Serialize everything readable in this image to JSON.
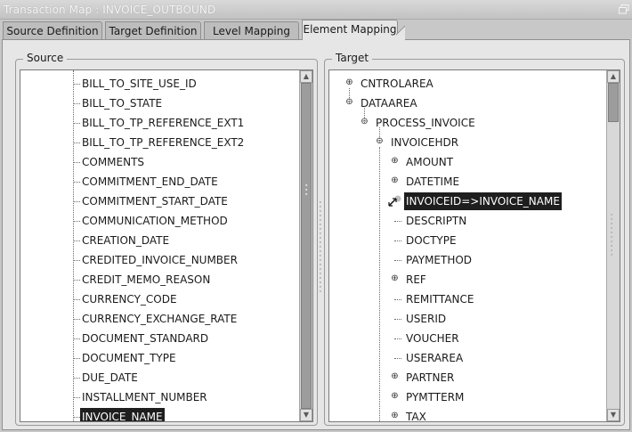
{
  "window": {
    "title": "Transaction Map : INVOICE_OUTBOUND",
    "restore_icon": "window-restore-icon"
  },
  "tabs": [
    {
      "label": "Source Definition",
      "active": false
    },
    {
      "label": "Target Definition",
      "active": false
    },
    {
      "label": "Level Mapping",
      "active": false
    },
    {
      "label": "Element Mapping",
      "active": true
    }
  ],
  "source": {
    "label": "Source",
    "items": [
      {
        "label": "BILL_TO_SITE_USE_ID",
        "selected": false
      },
      {
        "label": "BILL_TO_STATE",
        "selected": false
      },
      {
        "label": "BILL_TO_TP_REFERENCE_EXT1",
        "selected": false
      },
      {
        "label": "BILL_TO_TP_REFERENCE_EXT2",
        "selected": false
      },
      {
        "label": "COMMENTS",
        "selected": false
      },
      {
        "label": "COMMITMENT_END_DATE",
        "selected": false
      },
      {
        "label": "COMMITMENT_START_DATE",
        "selected": false
      },
      {
        "label": "COMMUNICATION_METHOD",
        "selected": false
      },
      {
        "label": "CREATION_DATE",
        "selected": false
      },
      {
        "label": "CREDITED_INVOICE_NUMBER",
        "selected": false
      },
      {
        "label": "CREDIT_MEMO_REASON",
        "selected": false
      },
      {
        "label": "CURRENCY_CODE",
        "selected": false
      },
      {
        "label": "CURRENCY_EXCHANGE_RATE",
        "selected": false
      },
      {
        "label": "DOCUMENT_STANDARD",
        "selected": false
      },
      {
        "label": "DOCUMENT_TYPE",
        "selected": false
      },
      {
        "label": "DUE_DATE",
        "selected": false
      },
      {
        "label": "INSTALLMENT_NUMBER",
        "selected": false
      },
      {
        "label": "INVOICE_NAME",
        "selected": true
      }
    ],
    "scroll_position": 0.55
  },
  "target": {
    "label": "Target",
    "items": [
      {
        "label": "CNTROLAREA",
        "level": 0,
        "expander": "collapsed",
        "selected": false
      },
      {
        "label": "DATAAREA",
        "level": 0,
        "expander": "expanded",
        "selected": false
      },
      {
        "label": "PROCESS_INVOICE",
        "level": 1,
        "expander": "expanded",
        "selected": false
      },
      {
        "label": "INVOICEHDR",
        "level": 2,
        "expander": "expanded",
        "selected": false
      },
      {
        "label": "AMOUNT",
        "level": 3,
        "expander": "collapsed",
        "selected": false
      },
      {
        "label": "DATETIME",
        "level": 3,
        "expander": "collapsed",
        "selected": false
      },
      {
        "label": "INVOICEID=>INVOICE_NAME",
        "level": 3,
        "expander": "mapped",
        "selected": true
      },
      {
        "label": "DESCRIPTN",
        "level": 3,
        "expander": "none",
        "selected": false
      },
      {
        "label": "DOCTYPE",
        "level": 3,
        "expander": "none",
        "selected": false
      },
      {
        "label": "PAYMETHOD",
        "level": 3,
        "expander": "none",
        "selected": false
      },
      {
        "label": "REF",
        "level": 3,
        "expander": "collapsed",
        "selected": false
      },
      {
        "label": "REMITTANCE",
        "level": 3,
        "expander": "none",
        "selected": false
      },
      {
        "label": "USERID",
        "level": 3,
        "expander": "none",
        "selected": false
      },
      {
        "label": "VOUCHER",
        "level": 3,
        "expander": "none",
        "selected": false
      },
      {
        "label": "USERAREA",
        "level": 3,
        "expander": "none",
        "selected": false
      },
      {
        "label": "PARTNER",
        "level": 3,
        "expander": "collapsed",
        "selected": false
      },
      {
        "label": "PYMTTERM",
        "level": 3,
        "expander": "collapsed",
        "selected": false
      },
      {
        "label": "TAX",
        "level": 3,
        "expander": "collapsed",
        "selected": false
      }
    ],
    "scroll_position": 0.0
  }
}
